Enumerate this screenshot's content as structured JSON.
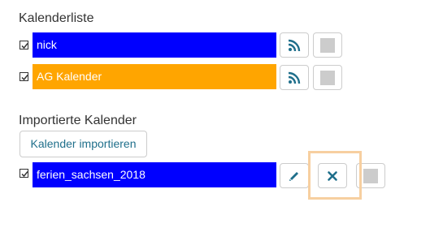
{
  "calendar_list": {
    "heading": "Kalenderliste",
    "items": [
      {
        "name": "nick",
        "color": "#0000ff",
        "checked": true
      },
      {
        "name": "AG Kalender",
        "color": "#ffa500",
        "checked": true
      }
    ]
  },
  "imported": {
    "heading": "Importierte Kalender",
    "import_button_label": "Kalender importieren",
    "items": [
      {
        "name": "ferien_sachsen_2018",
        "color": "#0000ff",
        "checked": true
      }
    ]
  },
  "icons": {
    "subscribe": "rss-icon",
    "edit": "pencil-icon",
    "delete": "close-icon",
    "color": "color-swatch-icon"
  },
  "accent": {
    "icon_color": "#1f6f8b",
    "highlight": "#f7cfa0"
  }
}
